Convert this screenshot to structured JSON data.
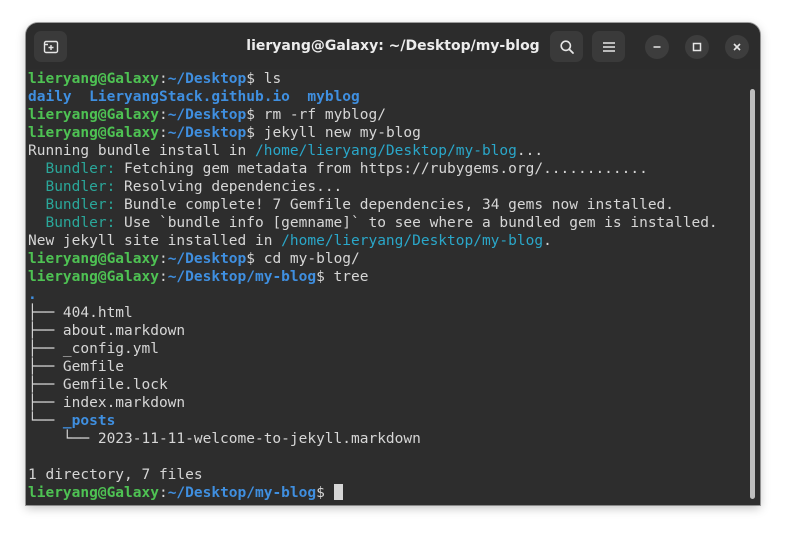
{
  "window": {
    "title": "lieryang@Galaxy: ~/Desktop/my-blog"
  },
  "titlebar": {
    "icons": {
      "new_tab": "new-tab-icon",
      "search": "search-icon",
      "menu": "hamburger-menu-icon",
      "minimize": "minimize-icon",
      "maximize": "maximize-icon",
      "close": "close-icon"
    }
  },
  "colors": {
    "prompt_user": "#4ec253",
    "prompt_path": "#3f8fe0",
    "path_text": "#2aa7c9",
    "bundler": "#2aa79a",
    "text": "#d6d6d6",
    "background": "#2d2d2d"
  },
  "terminal": {
    "prompt": {
      "user_host": "lieryang@Galaxy",
      "separator": ":",
      "path_desktop": "~/Desktop",
      "path_blog": "~/Desktop/my-blog",
      "dollar": "$"
    },
    "commands": {
      "ls": " ls",
      "rm": " rm -rf myblog/",
      "jekyll": " jekyll new my-blog",
      "cd": " cd my-blog/",
      "tree": " tree"
    },
    "ls_output": {
      "item1": "daily",
      "gap1": "  ",
      "item2": "LieryangStack.github.io",
      "gap2": "  ",
      "item3": "myblog"
    },
    "bundle_install": {
      "prefix": "Running bundle install in ",
      "path": "/home/lieryang/Desktop/my-blog",
      "suffix": "..."
    },
    "bundler_lines": [
      {
        "label": "  Bundler:",
        "text": " Fetching gem metadata from https://rubygems.org/............"
      },
      {
        "label": "  Bundler:",
        "text": " Resolving dependencies..."
      },
      {
        "label": "  Bundler:",
        "text": " Bundle complete! 7 Gemfile dependencies, 34 gems now installed."
      },
      {
        "label": "  Bundler:",
        "text": " Use `bundle info [gemname]` to see where a bundled gem is installed."
      }
    ],
    "installed": {
      "prefix": "New jekyll site installed in ",
      "path": "/home/lieryang/Desktop/my-blog",
      "suffix": "."
    },
    "tree": {
      "root": ".",
      "files": [
        "├── 404.html",
        "├── about.markdown",
        "├── _config.yml",
        "├── Gemfile",
        "├── Gemfile.lock",
        "├── index.markdown"
      ],
      "posts_prefix": "└── ",
      "posts_dir": "_posts",
      "posts_child": "    └── 2023-11-11-welcome-to-jekyll.markdown",
      "summary": "1 directory, 7 files"
    }
  }
}
